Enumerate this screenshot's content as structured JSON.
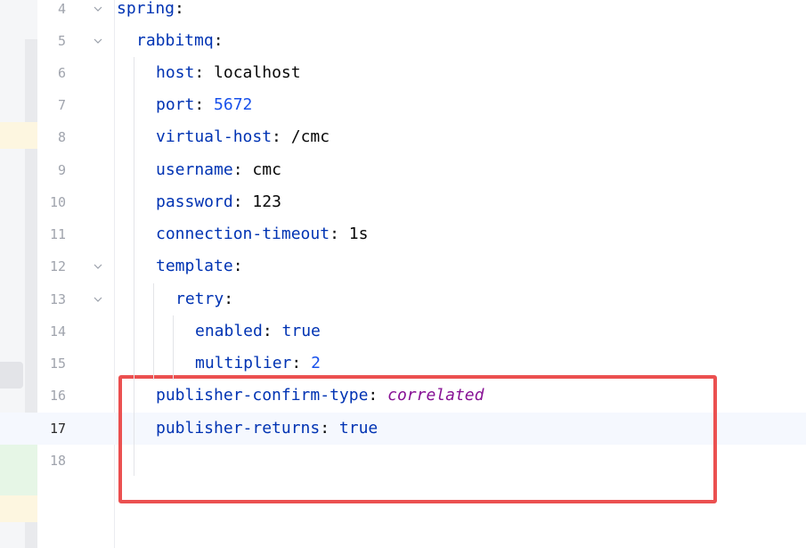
{
  "lines": [
    {
      "num": "4",
      "key": "spring",
      "sep": ":",
      "value": "",
      "value_type": "none"
    },
    {
      "num": "5",
      "key": "rabbitmq",
      "sep": ":",
      "value": "",
      "value_type": "none"
    },
    {
      "num": "6",
      "key": "host",
      "sep": ": ",
      "value": "localhost",
      "value_type": "plain"
    },
    {
      "num": "7",
      "key": "port",
      "sep": ": ",
      "value": "5672",
      "value_type": "number"
    },
    {
      "num": "8",
      "key": "virtual-host",
      "sep": ": ",
      "value": "/cmc",
      "value_type": "plain"
    },
    {
      "num": "9",
      "key": "username",
      "sep": ": ",
      "value": "cmc",
      "value_type": "plain"
    },
    {
      "num": "10",
      "key": "password",
      "sep": ": ",
      "value": "123",
      "value_type": "plain"
    },
    {
      "num": "11",
      "key": "connection-timeout",
      "sep": ": ",
      "value": "1s",
      "value_type": "plain"
    },
    {
      "num": "12",
      "key": "template",
      "sep": ":",
      "value": "",
      "value_type": "none"
    },
    {
      "num": "13",
      "key": "retry",
      "sep": ":",
      "value": "",
      "value_type": "none"
    },
    {
      "num": "14",
      "key": "enabled",
      "sep": ": ",
      "value": "true",
      "value_type": "keyword"
    },
    {
      "num": "15",
      "key": "multiplier",
      "sep": ": ",
      "value": "2",
      "value_type": "number"
    },
    {
      "num": "16",
      "key": "publisher-confirm-type",
      "sep": ": ",
      "value": "correlated",
      "value_type": "enum"
    },
    {
      "num": "17",
      "key": "publisher-returns",
      "sep": ": ",
      "value": "true",
      "value_type": "keyword"
    },
    {
      "num": "18",
      "key": "",
      "sep": "",
      "value": "",
      "value_type": "none"
    }
  ],
  "current_line": "17",
  "colors": {
    "key": "#0033b3",
    "number": "#1750eb",
    "enum": "#871094",
    "plain": "#080808",
    "highlight_box": "#eb5050",
    "current_line_bg": "#f5f8fe"
  },
  "icons": {
    "fold": "chevron-down-icon"
  }
}
